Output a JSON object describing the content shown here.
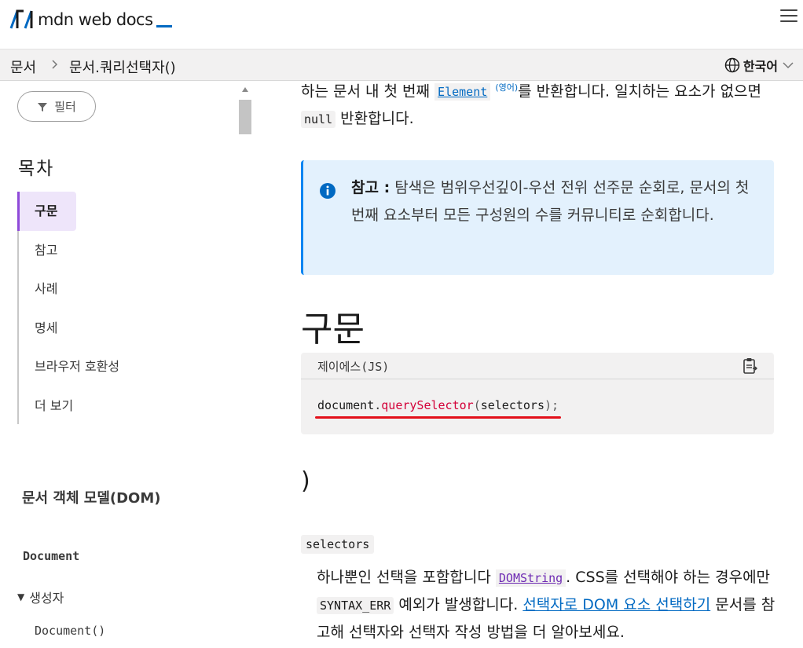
{
  "header": {
    "logo_text": "mdn web docs",
    "logo_icon": "mdn-logo-icon",
    "menu_icon": "hamburger-menu-icon"
  },
  "breadcrumb": {
    "items": [
      "문서",
      "문서.쿼리선택자()"
    ],
    "language": "한국어"
  },
  "sidebar": {
    "filter_label": "필터",
    "toc_title": "목차",
    "toc_items": [
      "구문",
      "참고",
      "사례",
      "명세",
      "브라우저 호환성",
      "더 보기"
    ],
    "active_index": 0,
    "section_title": "문서 객체 모델(DOM)",
    "document_link": "Document",
    "constructors_label": "생성자",
    "document_ctor": "Document()"
  },
  "main": {
    "intro": {
      "t1": "하는 문서 내 첫 번째 ",
      "element_link": "Element",
      "en_tag": "(영어)",
      "t2": "를 반환합니다. 일치하는 요소가 없으면 ",
      "null_code": "null",
      "t3": " 반환합니다."
    },
    "note": {
      "label": "참고 :",
      "text": " 탐색은 범위우선깊이-우선 전위 선주문 순회로, 문서의 첫 번째 요소부터 모든 구성원의 수를 커뮤니티로 순회합니다."
    },
    "syntax_heading": "구문",
    "code": {
      "language_label": "제이에스(JS)",
      "object": "document",
      "method": "querySelector",
      "arg": "selectors",
      "suffix": ");"
    },
    "stray_paren": ")",
    "param": {
      "name": "selectors",
      "d1": "하나뿐인 선택을 포함합니다 ",
      "domstring": "DOMString",
      "d2": ". CSS를 선택해야 하는 경우에만 ",
      "syntax_err": "SYNTAX_ERR",
      "d3": " 예외가 발생합니다. ",
      "guide_link": "선택자로 DOM 요소 선택하기",
      "d4": " 문서를 참고해 선택자와 선택자 작성 방법을 더 알아보세요."
    }
  },
  "colors": {
    "accent_blue": "#0069c2",
    "active_purple": "#8f4ad9",
    "note_bg": "#e3f1fd",
    "code_fn": "#d30038",
    "annotation_red": "#e3101a"
  }
}
